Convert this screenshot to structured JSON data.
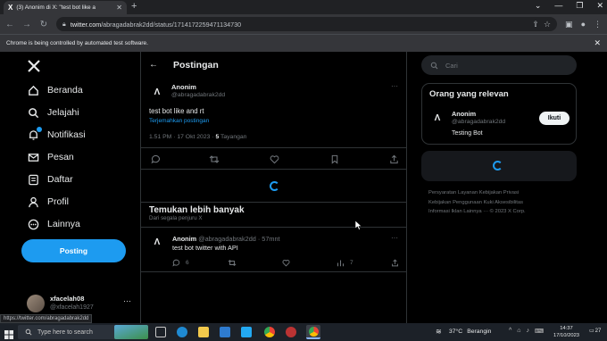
{
  "browser": {
    "tab_title": "(3) Anonim di X: \"test bot like a",
    "tab_favicon": "X",
    "url_host": "twitter.com",
    "url_path": "/abragadabrak2dd/status/1714172259471134730",
    "infobar_text": "Chrome is being controlled by automated test software.",
    "status_url": "https://twitter.com/abragadabrak2dd"
  },
  "nav": {
    "items": [
      {
        "label": "Beranda",
        "icon": "home-icon"
      },
      {
        "label": "Jelajahi",
        "icon": "search-icon"
      },
      {
        "label": "Notifikasi",
        "icon": "bell-icon"
      },
      {
        "label": "Pesan",
        "icon": "mail-icon"
      },
      {
        "label": "Daftar",
        "icon": "list-icon"
      },
      {
        "label": "Profil",
        "icon": "person-icon"
      },
      {
        "label": "Lainnya",
        "icon": "more-circle-icon"
      }
    ],
    "post_button": "Posting",
    "account_name": "xfacelah08",
    "account_handle": "@xfacelah1927"
  },
  "header": {
    "title": "Postingan"
  },
  "tweet": {
    "author": "Anonim",
    "handle": "@abragadabrak2dd",
    "text": "test bot like and rt",
    "translate": "Terjemahkan postingan",
    "time": "1.51 PM · 17 Okt 2023 · ",
    "views_count": "5",
    "views_label": " Tayangan"
  },
  "more_section": {
    "title": "Temukan lebih banyak",
    "subtitle": "Dari segala penjuru X",
    "tweet_author": "Anonim",
    "tweet_handle_time": "@abragadabrak2dd · 57mnt",
    "tweet_text": "test bot twitter with API",
    "reply_count": "6",
    "views_count": "7"
  },
  "right": {
    "search_placeholder": "Cari",
    "relevant_title": "Orang yang relevan",
    "person_name": "Anonim",
    "person_handle": "@abragadabrak2dd",
    "person_bio": "Testing Bot",
    "follow_label": "Ikuti",
    "footer_line1": "Persyaratan Layanan   Kebijakan Privasi",
    "footer_line2": "Kebijakan Penggunaan Kuki   Aksesibilitas",
    "footer_line3": "Informasi Iklan   Lainnya ···   © 2023 X Corp."
  },
  "taskbar": {
    "search_placeholder": "Type here to search",
    "weather_temp": "37°C",
    "weather_label": "Berangin",
    "time": "14:37",
    "date": "17/10/2023",
    "notification_count": "27"
  }
}
